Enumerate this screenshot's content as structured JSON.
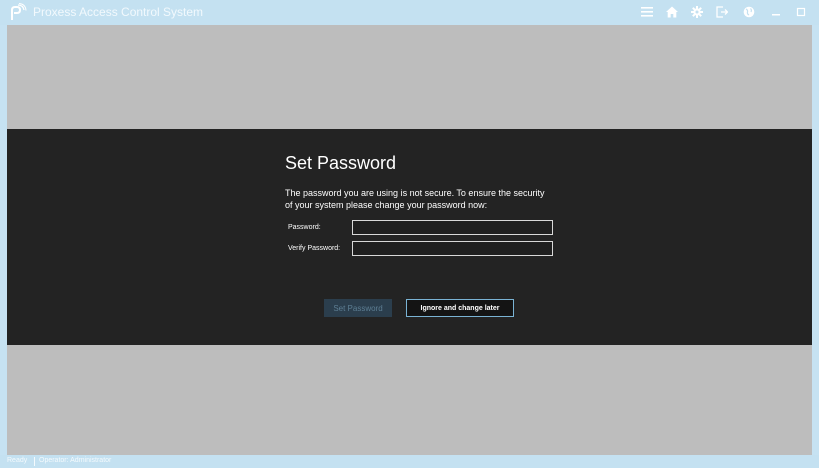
{
  "window": {
    "title": "Proxess Access Control System",
    "logo_icon": "proxess-logo-icon",
    "controls": [
      "menu-icon",
      "home-icon",
      "gear-icon",
      "logout-icon",
      "globe-icon",
      "minimize-icon",
      "maximize-icon"
    ]
  },
  "dialog": {
    "title": "Set Password",
    "message_line1": "The password you are using is not secure. To ensure the security",
    "message_line2": "of your system please change your password now:",
    "password_label": "Password:",
    "password_value": "",
    "verify_label": "Verify Password:",
    "verify_value": "",
    "set_button": "Set Password",
    "ignore_button": "Ignore and change later"
  },
  "status": {
    "state": "Ready",
    "operator": "Operator: Administrator"
  },
  "colors": {
    "frame": "#c4e1f1",
    "background": "#bdbdbd",
    "dialog": "#232323",
    "accent": "#7ab3d4"
  }
}
